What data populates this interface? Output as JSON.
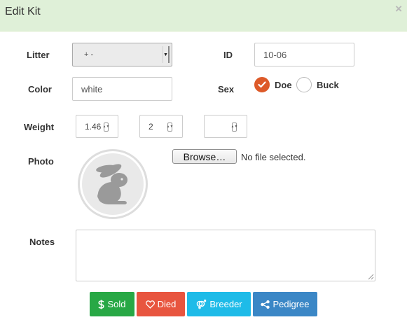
{
  "dialog": {
    "title": "Edit Kit",
    "close_label": "×"
  },
  "form": {
    "litter": {
      "label": "Litter",
      "value": "+ -"
    },
    "id": {
      "label": "ID",
      "value": "10-06"
    },
    "color": {
      "label": "Color",
      "value": "white"
    },
    "sex": {
      "label": "Sex",
      "options": [
        {
          "label": "Doe",
          "checked": true
        },
        {
          "label": "Buck",
          "checked": false
        }
      ]
    },
    "weight": {
      "label": "Weight",
      "fields": [
        "1.46",
        "2",
        ""
      ]
    },
    "photo": {
      "label": "Photo",
      "browse_label": "Browse…",
      "file_status": "No file selected.",
      "icon": "rabbit-icon"
    },
    "notes": {
      "label": "Notes",
      "value": ""
    }
  },
  "actions": [
    {
      "label": "Sold",
      "icon": "dollar-icon",
      "color": "#28a845"
    },
    {
      "label": "Died",
      "icon": "heart-outline-icon",
      "color": "#e8553f"
    },
    {
      "label": "Breeder",
      "icon": "gender-icon",
      "color": "#1ebbe8"
    },
    {
      "label": "Pedigree",
      "icon": "share-icon",
      "color": "#3b87c6"
    }
  ],
  "colors": {
    "header_bg": "#dff0d8",
    "radio_checked": "#dd5a29"
  }
}
